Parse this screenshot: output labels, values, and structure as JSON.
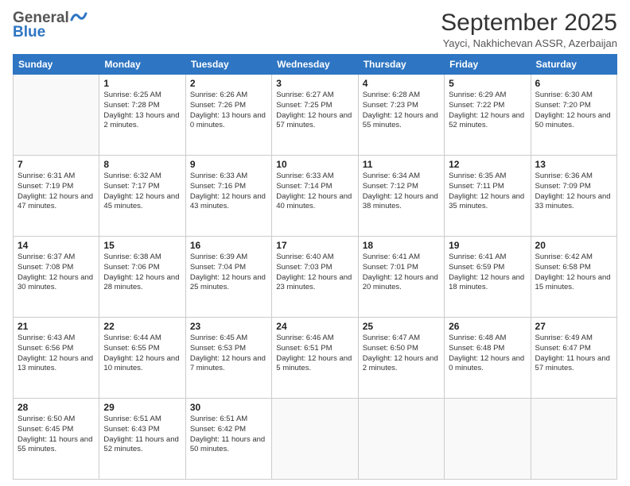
{
  "header": {
    "logo_general": "General",
    "logo_blue": "Blue",
    "month_title": "September 2025",
    "subtitle": "Yayci, Nakhichevan ASSR, Azerbaijan"
  },
  "weekdays": [
    "Sunday",
    "Monday",
    "Tuesday",
    "Wednesday",
    "Thursday",
    "Friday",
    "Saturday"
  ],
  "weeks": [
    [
      {
        "day": "",
        "info": ""
      },
      {
        "day": "1",
        "sunrise": "6:25 AM",
        "sunset": "7:28 PM",
        "daylight": "13 hours and 2 minutes."
      },
      {
        "day": "2",
        "sunrise": "6:26 AM",
        "sunset": "7:26 PM",
        "daylight": "13 hours and 0 minutes."
      },
      {
        "day": "3",
        "sunrise": "6:27 AM",
        "sunset": "7:25 PM",
        "daylight": "12 hours and 57 minutes."
      },
      {
        "day": "4",
        "sunrise": "6:28 AM",
        "sunset": "7:23 PM",
        "daylight": "12 hours and 55 minutes."
      },
      {
        "day": "5",
        "sunrise": "6:29 AM",
        "sunset": "7:22 PM",
        "daylight": "12 hours and 52 minutes."
      },
      {
        "day": "6",
        "sunrise": "6:30 AM",
        "sunset": "7:20 PM",
        "daylight": "12 hours and 50 minutes."
      }
    ],
    [
      {
        "day": "7",
        "sunrise": "6:31 AM",
        "sunset": "7:19 PM",
        "daylight": "12 hours and 47 minutes."
      },
      {
        "day": "8",
        "sunrise": "6:32 AM",
        "sunset": "7:17 PM",
        "daylight": "12 hours and 45 minutes."
      },
      {
        "day": "9",
        "sunrise": "6:33 AM",
        "sunset": "7:16 PM",
        "daylight": "12 hours and 43 minutes."
      },
      {
        "day": "10",
        "sunrise": "6:33 AM",
        "sunset": "7:14 PM",
        "daylight": "12 hours and 40 minutes."
      },
      {
        "day": "11",
        "sunrise": "6:34 AM",
        "sunset": "7:12 PM",
        "daylight": "12 hours and 38 minutes."
      },
      {
        "day": "12",
        "sunrise": "6:35 AM",
        "sunset": "7:11 PM",
        "daylight": "12 hours and 35 minutes."
      },
      {
        "day": "13",
        "sunrise": "6:36 AM",
        "sunset": "7:09 PM",
        "daylight": "12 hours and 33 minutes."
      }
    ],
    [
      {
        "day": "14",
        "sunrise": "6:37 AM",
        "sunset": "7:08 PM",
        "daylight": "12 hours and 30 minutes."
      },
      {
        "day": "15",
        "sunrise": "6:38 AM",
        "sunset": "7:06 PM",
        "daylight": "12 hours and 28 minutes."
      },
      {
        "day": "16",
        "sunrise": "6:39 AM",
        "sunset": "7:04 PM",
        "daylight": "12 hours and 25 minutes."
      },
      {
        "day": "17",
        "sunrise": "6:40 AM",
        "sunset": "7:03 PM",
        "daylight": "12 hours and 23 minutes."
      },
      {
        "day": "18",
        "sunrise": "6:41 AM",
        "sunset": "7:01 PM",
        "daylight": "12 hours and 20 minutes."
      },
      {
        "day": "19",
        "sunrise": "6:41 AM",
        "sunset": "6:59 PM",
        "daylight": "12 hours and 18 minutes."
      },
      {
        "day": "20",
        "sunrise": "6:42 AM",
        "sunset": "6:58 PM",
        "daylight": "12 hours and 15 minutes."
      }
    ],
    [
      {
        "day": "21",
        "sunrise": "6:43 AM",
        "sunset": "6:56 PM",
        "daylight": "12 hours and 13 minutes."
      },
      {
        "day": "22",
        "sunrise": "6:44 AM",
        "sunset": "6:55 PM",
        "daylight": "12 hours and 10 minutes."
      },
      {
        "day": "23",
        "sunrise": "6:45 AM",
        "sunset": "6:53 PM",
        "daylight": "12 hours and 7 minutes."
      },
      {
        "day": "24",
        "sunrise": "6:46 AM",
        "sunset": "6:51 PM",
        "daylight": "12 hours and 5 minutes."
      },
      {
        "day": "25",
        "sunrise": "6:47 AM",
        "sunset": "6:50 PM",
        "daylight": "12 hours and 2 minutes."
      },
      {
        "day": "26",
        "sunrise": "6:48 AM",
        "sunset": "6:48 PM",
        "daylight": "12 hours and 0 minutes."
      },
      {
        "day": "27",
        "sunrise": "6:49 AM",
        "sunset": "6:47 PM",
        "daylight": "11 hours and 57 minutes."
      }
    ],
    [
      {
        "day": "28",
        "sunrise": "6:50 AM",
        "sunset": "6:45 PM",
        "daylight": "11 hours and 55 minutes."
      },
      {
        "day": "29",
        "sunrise": "6:51 AM",
        "sunset": "6:43 PM",
        "daylight": "11 hours and 52 minutes."
      },
      {
        "day": "30",
        "sunrise": "6:51 AM",
        "sunset": "6:42 PM",
        "daylight": "11 hours and 50 minutes."
      },
      {
        "day": "",
        "info": ""
      },
      {
        "day": "",
        "info": ""
      },
      {
        "day": "",
        "info": ""
      },
      {
        "day": "",
        "info": ""
      }
    ]
  ]
}
